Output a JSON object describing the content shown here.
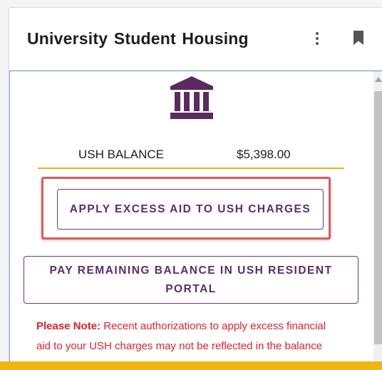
{
  "header": {
    "title": "University Student Housing",
    "menu_icon": "more-vert-icon",
    "bookmark_icon": "bookmark-icon"
  },
  "main": {
    "icon": "bank-building-icon",
    "balance_label": "USH BALANCE",
    "balance_amount": "$5,398.00",
    "apply_button": "APPLY EXCESS AID TO USH CHARGES",
    "pay_button": "PAY REMAINING BALANCE IN USH RESIDENT PORTAL",
    "note_label": "Please Note:",
    "note_text": " Recent authorizations to apply excess financial aid to your USH charges may not be reflected in the balance shown above."
  },
  "colors": {
    "brand_purple": "#6a3a7d",
    "accent_gold": "#e0b81a",
    "note_red": "#e0232c",
    "highlight_red": "#e05a5a"
  }
}
